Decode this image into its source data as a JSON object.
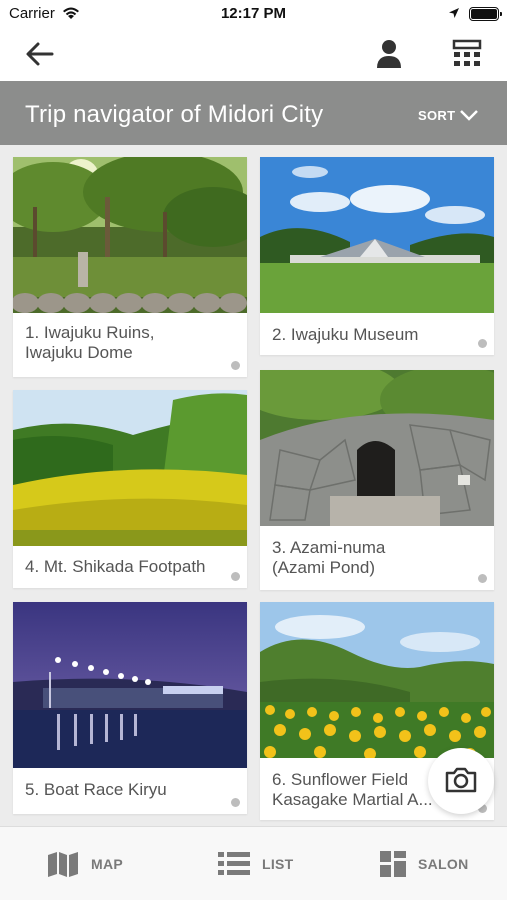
{
  "status": {
    "carrier": "Carrier",
    "time": "12:17 PM"
  },
  "nav": {
    "back_icon": "arrow-left-icon",
    "user_icon": "user-icon",
    "calc_icon": "calculator-icon"
  },
  "header": {
    "title": "Trip navigator of Midori City",
    "sort_label": "SORT"
  },
  "spots": [
    {
      "label": "1. Iwajuku Ruins,\nIwajuku Dome"
    },
    {
      "label": "2. Iwajuku Museum"
    },
    {
      "label": "4. Mt. Shikada Footpath"
    },
    {
      "label": "3. Azami-numa\n(Azami Pond)"
    },
    {
      "label": "5. Boat Race Kiryu"
    },
    {
      "label": "6. Sunflower Field\nKasagake Martial A..."
    }
  ],
  "tabs": [
    {
      "label": "MAP",
      "icon": "map-icon"
    },
    {
      "label": "LIST",
      "icon": "list-icon"
    },
    {
      "label": "SALON",
      "icon": "grid-icon"
    }
  ],
  "colors": {
    "title_bar": "#8c8d8c",
    "tab_text": "#7a7a7a"
  }
}
